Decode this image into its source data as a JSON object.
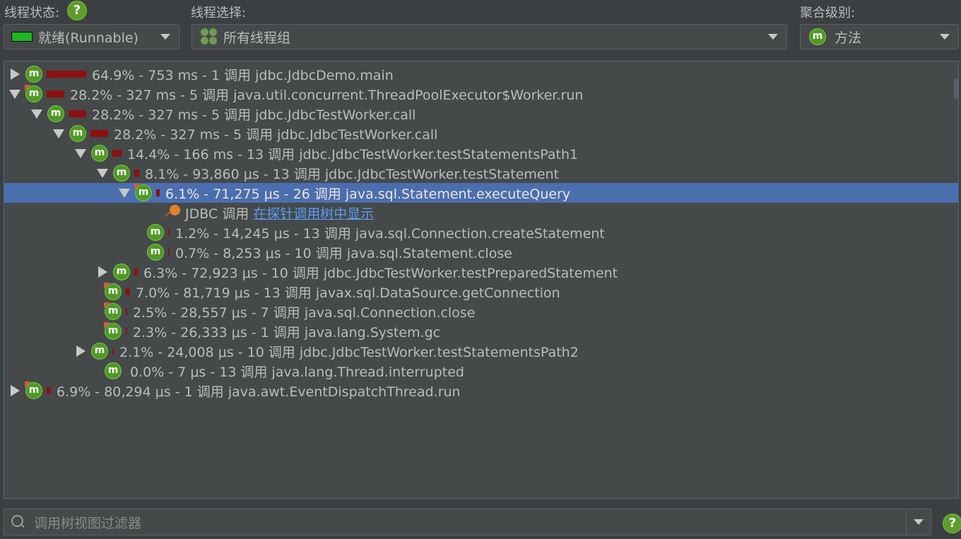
{
  "thread_status": {
    "label": "线程状态:",
    "value": "就绪(Runnable)",
    "swatch_color": "#1fb523"
  },
  "thread_select": {
    "label": "线程选择:",
    "value": "所有线程组"
  },
  "aggregation": {
    "label": "聚合级别:",
    "value": "方法",
    "icon": "m"
  },
  "help_glyph": "?",
  "tree_rows": [
    {
      "text": "64.9% - 753 ms - 1 调用 jdbc.JdbcDemo.main",
      "expander": "collapsed",
      "bar_pct": 64.9
    },
    {
      "text": "28.2% - 327 ms - 5 调用 java.util.concurrent.ThreadPoolExecutor$Worker.run",
      "expander": "expanded",
      "bar_pct": 28.2
    },
    {
      "text": "28.2% - 327 ms - 5 调用 jdbc.JdbcTestWorker.call",
      "expander": "expanded",
      "bar_pct": 28.2
    },
    {
      "text": "28.2% - 327 ms - 5 调用 jdbc.JdbcTestWorker.call",
      "expander": "expanded",
      "bar_pct": 28.2
    },
    {
      "text": "14.4% - 166 ms - 13 调用 jdbc.JdbcTestWorker.testStatementsPath1",
      "expander": "expanded",
      "bar_pct": 14.4
    },
    {
      "text": "8.1% - 93,860 μs - 13 调用 jdbc.JdbcTestWorker.testStatement",
      "expander": "expanded",
      "bar_pct": 8.1
    },
    {
      "text": "6.1% - 71,275 μs - 26 调用 java.sql.Statement.executeQuery",
      "expander": "expanded",
      "bar_pct": 6.1,
      "selected": true
    },
    {
      "text": "JDBC 调用",
      "link": "在探针调用树中显示",
      "probe": true
    },
    {
      "text": "1.2% - 14,245 μs - 13 调用 java.sql.Connection.createStatement",
      "bar_pct": 1.2
    },
    {
      "text": "0.7% - 8,253 μs - 10 调用 java.sql.Statement.close",
      "bar_pct": 0.7
    },
    {
      "text": "6.3% - 72,923 μs - 10 调用 jdbc.JdbcTestWorker.testPreparedStatement",
      "expander": "collapsed",
      "bar_pct": 6.3
    },
    {
      "text": "7.0% - 81,719 μs - 13 调用 javax.sql.DataSource.getConnection",
      "bar_pct": 7.0
    },
    {
      "text": "2.5% - 28,557 μs - 7 调用 java.sql.Connection.close",
      "bar_pct": 2.5
    },
    {
      "text": "2.3% - 26,333 μs - 1 调用 java.lang.System.gc",
      "bar_pct": 2.3
    },
    {
      "text": "2.1% - 24,008 μs - 10 调用 jdbc.JdbcTestWorker.testStatementsPath2",
      "expander": "collapsed",
      "bar_pct": 2.1
    },
    {
      "text": "0.0% - 7 μs - 13 调用 java.lang.Thread.interrupted",
      "bar_pct": 0.0
    },
    {
      "text": "6.9% - 80,294 μs - 1 调用 java.awt.EventDispatchThread.run",
      "expander": "collapsed",
      "bar_pct": 6.9
    }
  ],
  "filter": {
    "placeholder": "调用树视图过滤器"
  },
  "colors": {
    "selection": "#4b6eaf",
    "bar": "#8b1111",
    "link": "#589df6",
    "method_icon": "#4f9a25"
  }
}
